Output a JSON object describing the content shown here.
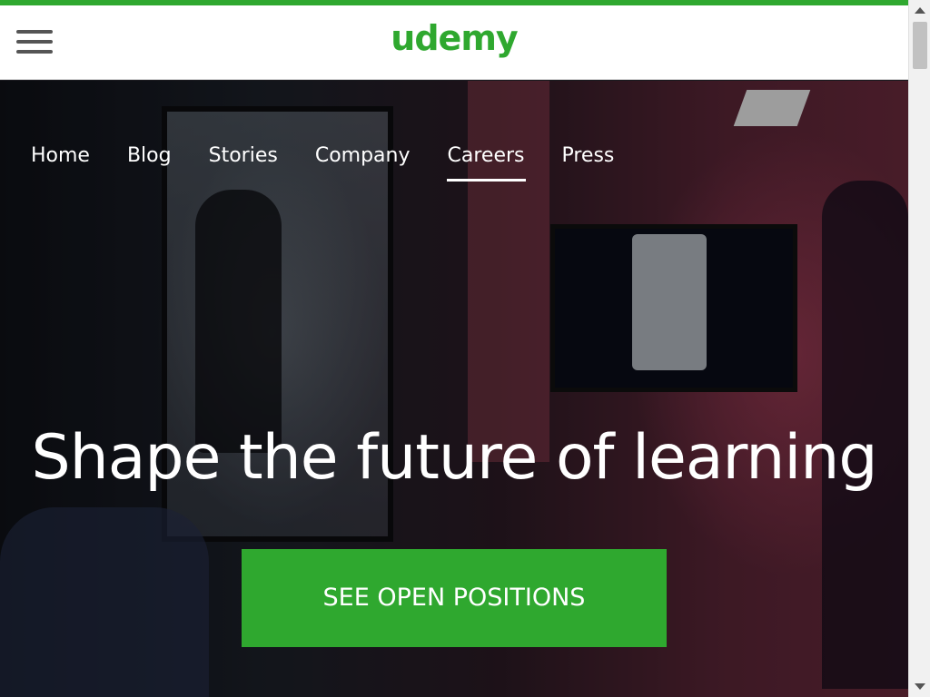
{
  "header": {
    "logo_text": "udemy",
    "accent_color": "#2fa82f"
  },
  "nav": {
    "items": [
      {
        "label": "Home"
      },
      {
        "label": "Blog"
      },
      {
        "label": "Stories"
      },
      {
        "label": "Company"
      },
      {
        "label": "Careers",
        "active": true
      },
      {
        "label": "Press"
      }
    ]
  },
  "hero": {
    "headline": "Shape the future of learning",
    "cta_label": "SEE OPEN POSITIONS"
  }
}
